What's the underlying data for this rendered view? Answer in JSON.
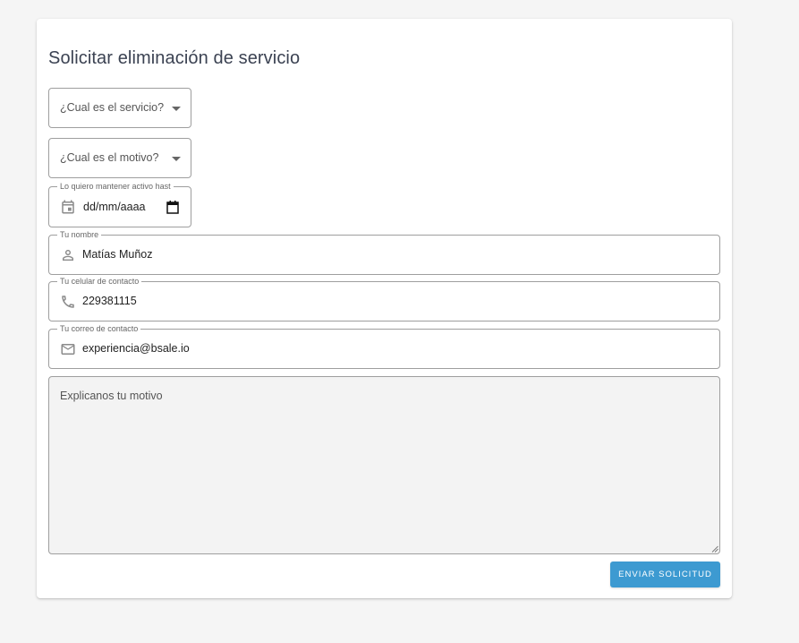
{
  "form": {
    "title": "Solicitar eliminación de servicio",
    "service_select": {
      "value": "¿Cual es el servicio?"
    },
    "reason_select": {
      "value": "¿Cual es el motivo?"
    },
    "keep_active": {
      "label": "Lo quiero mantener activo hast",
      "value": "dd/mm/aaaa"
    },
    "name": {
      "label": "Tu nombre",
      "value": "Matías Muñoz",
      "icon": "person-icon"
    },
    "phone": {
      "label": "Tu celular de contacto",
      "value": "229381115",
      "icon": "phone-icon"
    },
    "email": {
      "label": "Tu correo de contacto",
      "value": "experiencia@bsale.io",
      "icon": "mail-icon"
    },
    "explanation": {
      "placeholder": "Explicanos tu motivo"
    },
    "submit_label": "ENVIAR SOLICITUD"
  },
  "colors": {
    "accent": "#3d9ad1",
    "page_background": "#f5f5f5",
    "textarea_background": "#f3f3f3"
  }
}
